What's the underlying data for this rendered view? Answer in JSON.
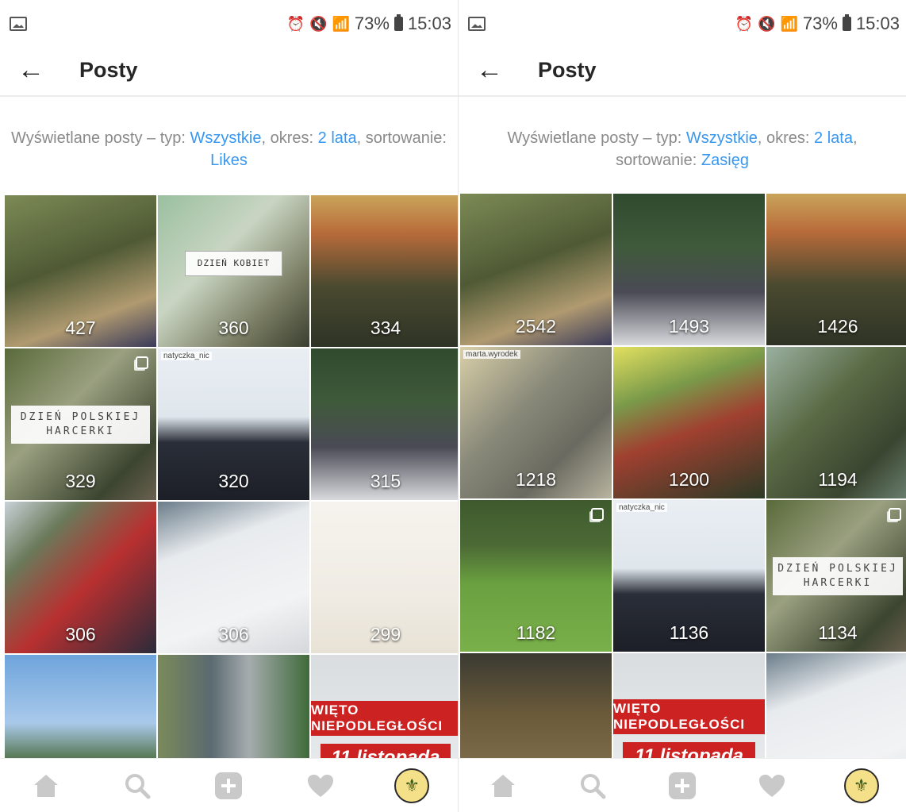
{
  "screens": [
    {
      "status": {
        "battery": "73%",
        "time": "15:03"
      },
      "title": "Posty",
      "filter": {
        "prefix": "Wyświetlane posty – typ: ",
        "type": "Wszystkie",
        "period_label": ", okres: ",
        "period": "2 lata",
        "sort_label": ", sortowanie: ",
        "sort": "Likes"
      },
      "tiles": [
        {
          "count": "427",
          "caption": "",
          "bg": "linear-gradient(160deg,#7c8a55 0%,#4f5a35 45%,#b09a70 75%,#3a3a5a 100%)"
        },
        {
          "count": "360",
          "caption": "DZIEŃ KOBIET",
          "caption_small": true,
          "bg": "linear-gradient(135deg,#9ac0a0 0%,#c9d5c2 40%,#777a60 75%,#3a3f30 100%)"
        },
        {
          "count": "334",
          "caption": "",
          "bg": "linear-gradient(180deg,#c9a45a 0%,#b86b3a 25%,#4a4a30 60%,#2e3325 100%)"
        },
        {
          "count": "329",
          "caption": "DZIEŃ POLSKIEJ HARCERKI",
          "multi": true,
          "bg": "linear-gradient(135deg,#5a6a3a 0%,#9aa080 40%,#3c4530 80%,#6a6050 100%)"
        },
        {
          "count": "320",
          "caption": "",
          "tag": "natyczka_nic",
          "bg": "linear-gradient(180deg,#e9eef3 0%,#dfe6ec 45%,#2a2e38 62%,#1c1f27 100%)"
        },
        {
          "count": "315",
          "caption": "",
          "bg": "linear-gradient(180deg,#2f4a2e 0%,#3f5a3a 35%,#4a4a55 65%,#d8dadd 100%)"
        },
        {
          "count": "306",
          "caption": "",
          "bg": "linear-gradient(135deg,#c9d2d8 0%,#6a7a5a 25%,#b83030 55%,#2b2b3a 100%)"
        },
        {
          "count": "306",
          "caption": "",
          "bg": "linear-gradient(160deg,#6b7d8a 0%,#e8ebee 30%,#f2f3f4 70%,#d5d8db 100%)"
        },
        {
          "count": "299",
          "caption": "",
          "bg": "linear-gradient(180deg,#f6f3ee 0%,#f0ece4 60%,#e8e2d6 100%)"
        },
        {
          "count": "",
          "caption": "",
          "bg": "linear-gradient(180deg,#6ea4dc 0%,#a9c9ea 45%,#4a6a3a 72%,#6b8a40 100%)"
        },
        {
          "count": "",
          "caption": "",
          "bg": "linear-gradient(90deg,#7a8a5a 0%,#5a6a70 35%,#a6acae 60%,#3f6a3a 100%)"
        },
        {
          "count": "",
          "caption": "",
          "banner": "WIĘTO NIEPODLEGŁOŚCI",
          "banner2": "11 listopada",
          "bg": "linear-gradient(180deg,#d9dde0 0%,#eceeef 100%)"
        }
      ],
      "nav": [
        "home-icon",
        "search-icon",
        "add-icon",
        "heart-icon",
        "profile-avatar"
      ]
    },
    {
      "status": {
        "battery": "73%",
        "time": "15:03"
      },
      "title": "Posty",
      "filter": {
        "prefix": "Wyświetlane posty – typ: ",
        "type": "Wszystkie",
        "period_label": ", okres: ",
        "period": "2 lata",
        "sort_label": ", sortowanie: ",
        "sort": "Zasięg"
      },
      "tiles": [
        {
          "count": "2542",
          "caption": "",
          "bg": "linear-gradient(160deg,#7c8a55 0%,#4f5a35 45%,#b09a70 75%,#3a3a5a 100%)"
        },
        {
          "count": "1493",
          "caption": "",
          "bg": "linear-gradient(180deg,#2f4a2e 0%,#3f5a3a 35%,#4a4a55 65%,#d8dadd 100%)"
        },
        {
          "count": "1426",
          "caption": "",
          "bg": "linear-gradient(180deg,#c9a45a 0%,#b86b3a 25%,#4a4a30 60%,#2e3325 100%)"
        },
        {
          "count": "1218",
          "caption": "",
          "tag": "marta.wyrodek",
          "bg": "linear-gradient(135deg,#d9cfa8 0%,#8a8a7a 40%,#6a6a60 70%,#b9b4a0 100%)"
        },
        {
          "count": "1200",
          "caption": "",
          "bg": "linear-gradient(160deg,#e2e060 0%,#7a9a4a 30%,#a04030 55%,#2a3a25 100%)"
        },
        {
          "count": "1194",
          "caption": "",
          "bg": "linear-gradient(135deg,#9ab0a0 0%,#5a6a45 40%,#3a4530 75%,#6a8070 100%)"
        },
        {
          "count": "1182",
          "caption": "",
          "multi": true,
          "bg": "linear-gradient(180deg,#3e5a2e 0%,#4c6a35 30%,#6aa040 55%,#7ab04a 100%)"
        },
        {
          "count": "1136",
          "caption": "",
          "tag": "natyczka_nic",
          "bg": "linear-gradient(180deg,#e9eef3 0%,#dfe6ec 45%,#2a2e38 62%,#1c1f27 100%)"
        },
        {
          "count": "1134",
          "caption": "DZIEŃ POLSKIEJ HARCERKI",
          "multi": true,
          "bg": "linear-gradient(135deg,#5a6a3a 0%,#9aa080 40%,#3c4530 80%,#6a6050 100%)"
        },
        {
          "count": "",
          "caption": "",
          "bg": "linear-gradient(180deg,#3a3a32 0%,#6a5a3a 40%,#7a6a4a 70%,#3a3025 100%)"
        },
        {
          "count": "",
          "caption": "",
          "banner": "WIĘTO NIEPODLEGŁOŚCI",
          "banner2": "11 listopada",
          "bg": "linear-gradient(180deg,#d9dde0 0%,#eceeef 100%)"
        },
        {
          "count": "",
          "caption": "",
          "bg": "linear-gradient(160deg,#6b7d8a 0%,#e8ebee 30%,#f2f3f4 70%,#d5d8db 100%)"
        }
      ],
      "nav": [
        "home-icon",
        "search-icon",
        "add-icon",
        "heart-icon",
        "profile-avatar"
      ]
    }
  ]
}
